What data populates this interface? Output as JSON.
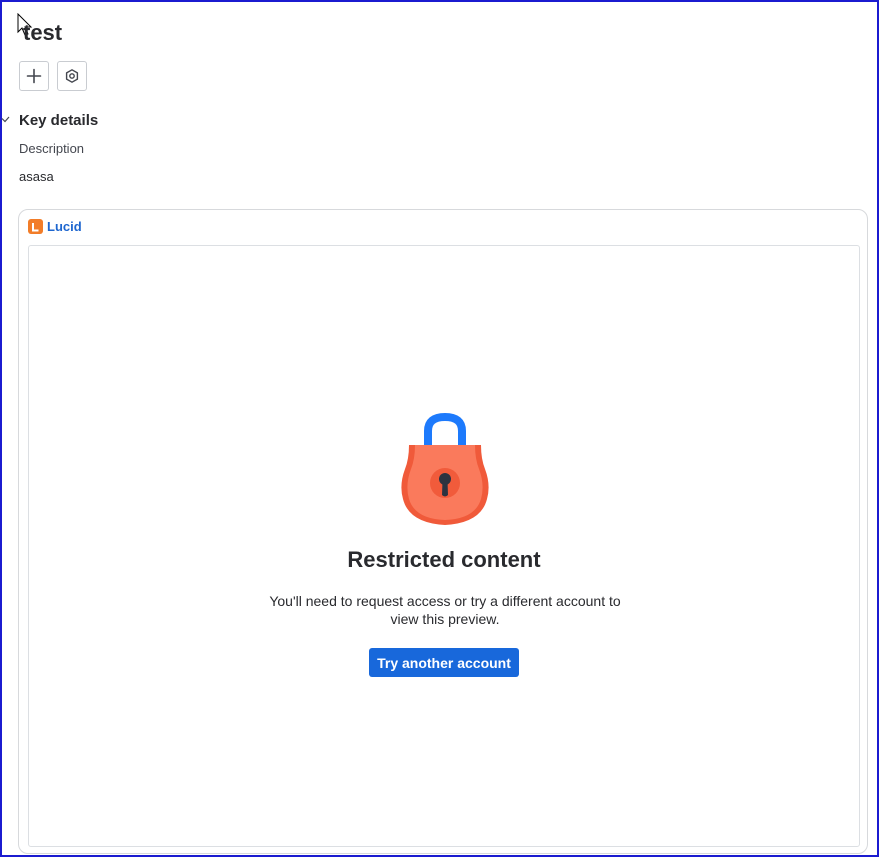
{
  "page": {
    "title": "test"
  },
  "toolbar": {
    "buttons": [
      {
        "icon": "plus-icon"
      },
      {
        "icon": "settings-icon"
      }
    ]
  },
  "details": {
    "section_title": "Key details",
    "description_label": "Description",
    "description_value": "asasa"
  },
  "embed": {
    "provider": "Lucid",
    "title": "Restricted content",
    "message": "You'll need to request access or try a different account to view this preview.",
    "button_label": "Try another account"
  },
  "colors": {
    "frame": "#1b1bd0",
    "link": "#1e66cf",
    "primary_button": "#1868db",
    "lucid_brand": "#f27d29",
    "lock_body": "#f05a3a",
    "lock_shackle": "#1d7afc"
  }
}
